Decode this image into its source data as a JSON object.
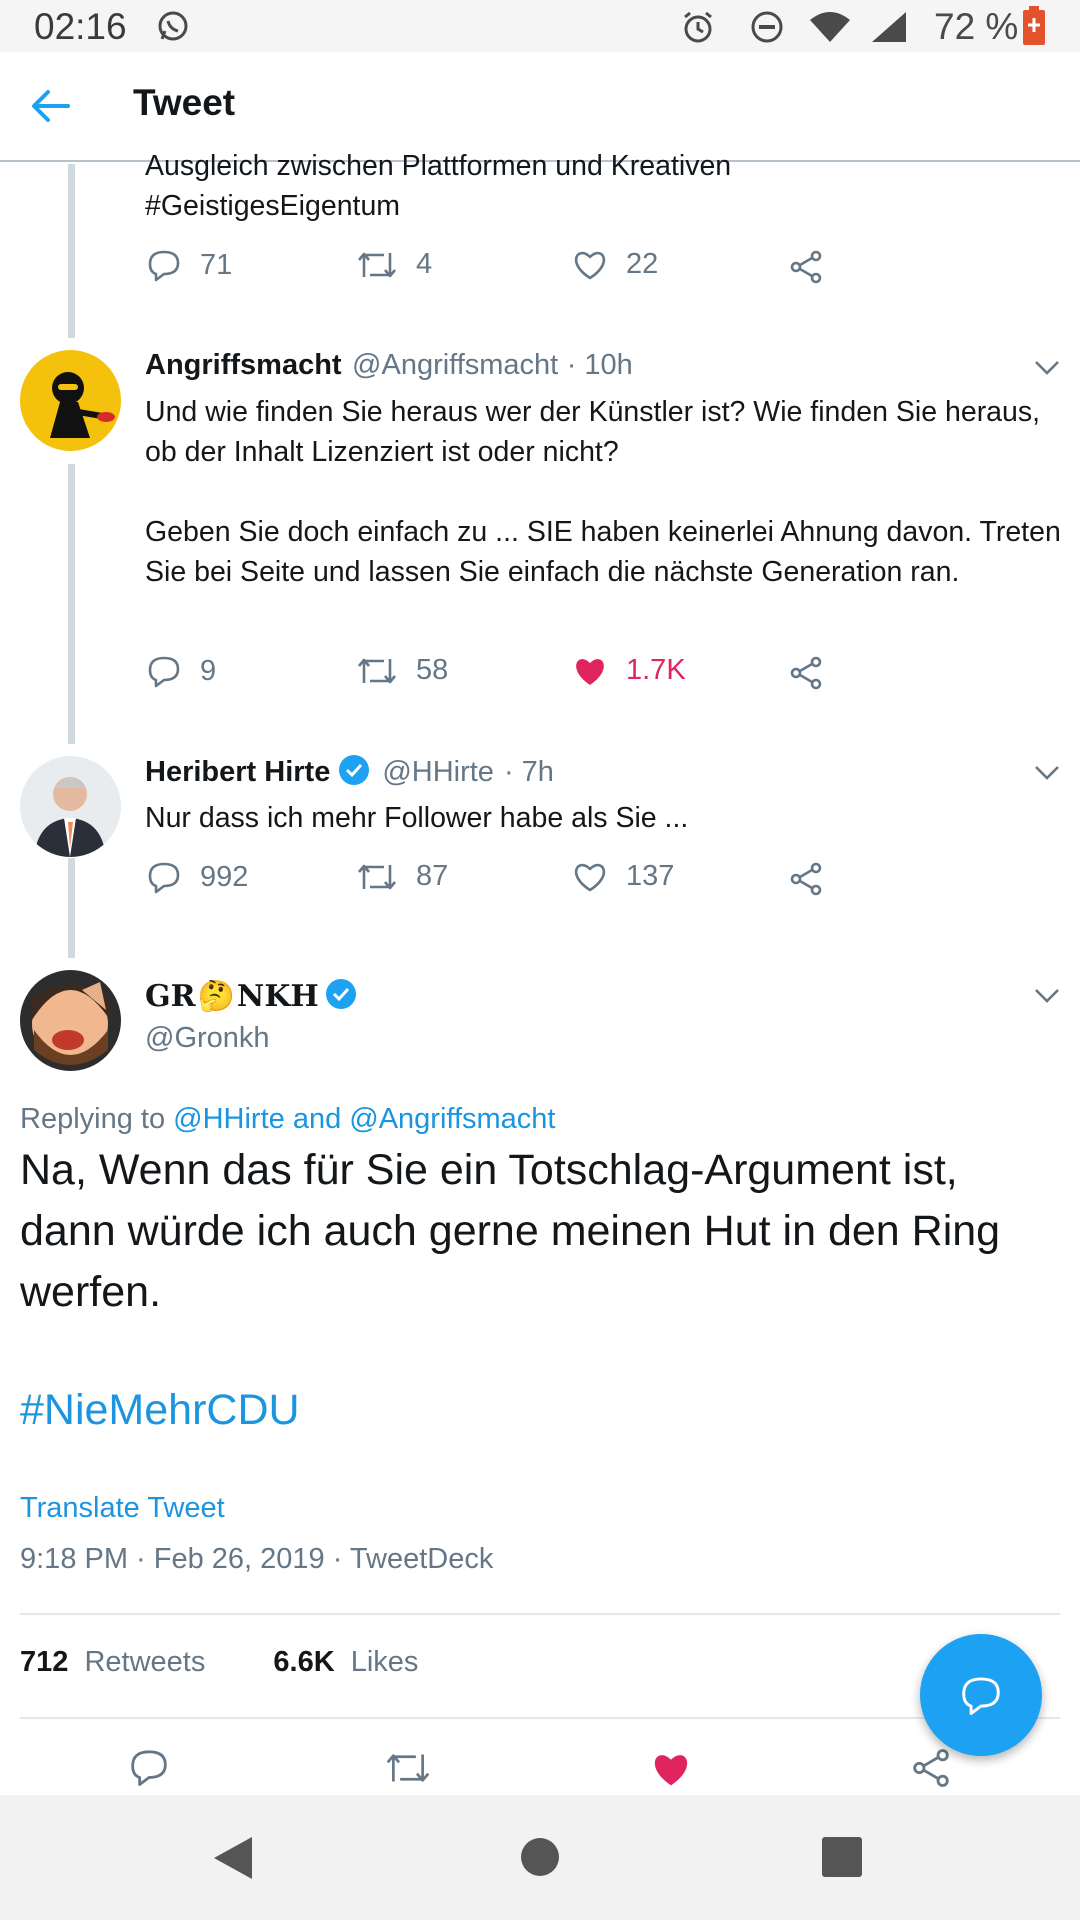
{
  "status_bar": {
    "time": "02:16",
    "battery": "72 %",
    "icons": [
      "whatsapp-icon",
      "alarm-icon",
      "do-not-disturb-icon",
      "wifi-icon",
      "signal-icon",
      "battery-icon"
    ]
  },
  "header": {
    "title": "Tweet",
    "back_icon": "arrow-left-icon"
  },
  "thread": [
    {
      "text_line1": "Ausgleich zwischen Plattformen und Kreativen",
      "hashtag": "#GeistigesEigentum",
      "replies": "71",
      "retweets": "4",
      "likes": "22"
    },
    {
      "name": "Angriffsmacht",
      "handle": "@Angriffsmacht",
      "time": "· 10h",
      "p1": "Und wie finden Sie heraus wer der Künstler ist? Wie finden Sie heraus, ob der Inhalt Lizenziert ist oder nicht?",
      "p2": "Geben Sie doch einfach zu ... SIE haben keinerlei Ahnung davon. Treten Sie bei Seite und lassen Sie einfach die nächste Generation ran.",
      "replies": "9",
      "retweets": "58",
      "likes": "1.7K",
      "liked": true
    },
    {
      "name": "Heribert Hirte",
      "handle": "@HHirte",
      "time": "· 7h",
      "text": "Nur dass ich mehr Follower habe als Sie ...",
      "replies": "992",
      "retweets": "87",
      "likes": "137"
    }
  ],
  "main_tweet": {
    "name_prefix": "GR",
    "name_emoji": "🤔",
    "name_suffix": "NKH",
    "handle": "@Gronkh",
    "replying_label": "Replying to",
    "replying_to": "@HHirte and @Angriffsmacht",
    "text": "Na, Wenn das für Sie ein Totschlag-Argument ist, dann würde ich auch gerne meinen Hut in den Ring werfen.",
    "hashtag": "#NieMehrCDU",
    "translate": "Translate Tweet",
    "timestamp": "9:18 PM · Feb 26, 2019 · TweetDeck",
    "retweet_count": "712",
    "retweet_label": "Retweets",
    "like_count": "6.6K",
    "like_label": "Likes"
  },
  "colors": {
    "accent": "#1da1f2",
    "like": "#e0245e",
    "text": "#14171a",
    "muted": "#657786"
  }
}
